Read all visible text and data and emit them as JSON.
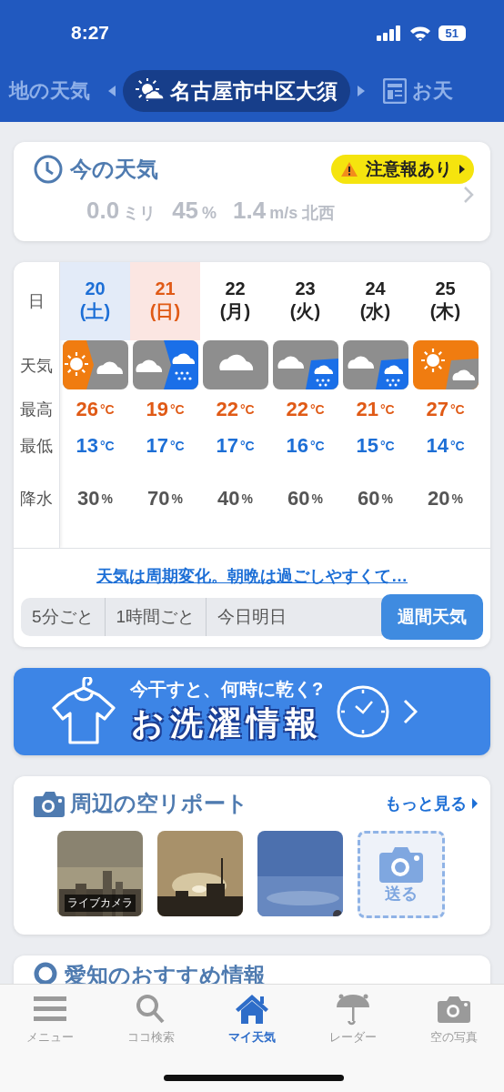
{
  "status_bar": {
    "time": "8:27",
    "battery": "51"
  },
  "location_tabs": [
    {
      "label": "地の天気",
      "selected": false
    },
    {
      "label": "名古屋市中区大須",
      "selected": true
    },
    {
      "label": "お天",
      "selected": false
    }
  ],
  "now_card": {
    "title": "今の天気",
    "alert": "注意報あり",
    "readings": [
      {
        "value": "0.0",
        "unit": "ミリ"
      },
      {
        "value": "45",
        "unit": "%"
      },
      {
        "value": "1.4",
        "unit": "m/s 北西"
      }
    ]
  },
  "forecast": {
    "row_labels": {
      "date": "日",
      "weather": "天気",
      "high": "最高",
      "low": "最低",
      "rain": "降水"
    },
    "days": [
      {
        "date": "20",
        "weekday": "(土)",
        "kind": "saturday",
        "weather": {
          "kind": "sunny_then_cloudy"
        },
        "high": "26",
        "high_unit": "°C",
        "low": "13",
        "low_unit": "°C",
        "rain": "30",
        "rain_unit": "%"
      },
      {
        "date": "21",
        "weekday": "(日)",
        "kind": "sunday",
        "weather": {
          "kind": "cloudy_then_rain"
        },
        "high": "19",
        "high_unit": "°C",
        "low": "17",
        "low_unit": "°C",
        "rain": "70",
        "rain_unit": "%"
      },
      {
        "date": "22",
        "weekday": "(月)",
        "kind": "weekday",
        "weather": {
          "kind": "cloudy"
        },
        "high": "22",
        "high_unit": "°C",
        "low": "17",
        "low_unit": "°C",
        "rain": "40",
        "rain_unit": "%"
      },
      {
        "date": "23",
        "weekday": "(火)",
        "kind": "weekday",
        "weather": {
          "kind": "cloudy_rain_later"
        },
        "high": "22",
        "high_unit": "°C",
        "low": "16",
        "low_unit": "°C",
        "rain": "60",
        "rain_unit": "%"
      },
      {
        "date": "24",
        "weekday": "(水)",
        "kind": "weekday",
        "weather": {
          "kind": "cloudy_rain_later"
        },
        "high": "21",
        "high_unit": "°C",
        "low": "15",
        "low_unit": "°C",
        "rain": "60",
        "rain_unit": "%"
      },
      {
        "date": "25",
        "weekday": "(木)",
        "kind": "weekday",
        "weather": {
          "kind": "sunny_cloudy_later"
        },
        "high": "27",
        "high_unit": "°C",
        "low": "14",
        "low_unit": "°C",
        "rain": "20",
        "rain_unit": "%"
      }
    ],
    "summary_link": "天気は周期変化。朝晩は過ごしやすくて…",
    "views": [
      {
        "label": "5分ごと",
        "selected": false
      },
      {
        "label": "1時間ごと",
        "selected": false
      },
      {
        "label": "今日明日",
        "selected": false
      },
      {
        "label": "週間天気",
        "selected": true
      }
    ]
  },
  "laundry_banner": {
    "question": "今干すと、何時に乾く?",
    "title": "お洗濯情報"
  },
  "sky_report": {
    "title": "周辺の空リポート",
    "more": "もっと見る",
    "photos": [
      {
        "kind": "picture",
        "caption": "ライブカメラ"
      },
      {
        "kind": "picture"
      },
      {
        "kind": "picture"
      }
    ],
    "send": "送る"
  },
  "recommend": {
    "title": "愛知のおすすめ情報"
  },
  "bottom_nav": [
    {
      "label": "メニュー",
      "selected": false
    },
    {
      "label": "ココ検索",
      "selected": false
    },
    {
      "label": "マイ天気",
      "selected": true
    },
    {
      "label": "レーダー",
      "selected": false
    },
    {
      "label": "空の写真",
      "selected": false
    }
  ]
}
